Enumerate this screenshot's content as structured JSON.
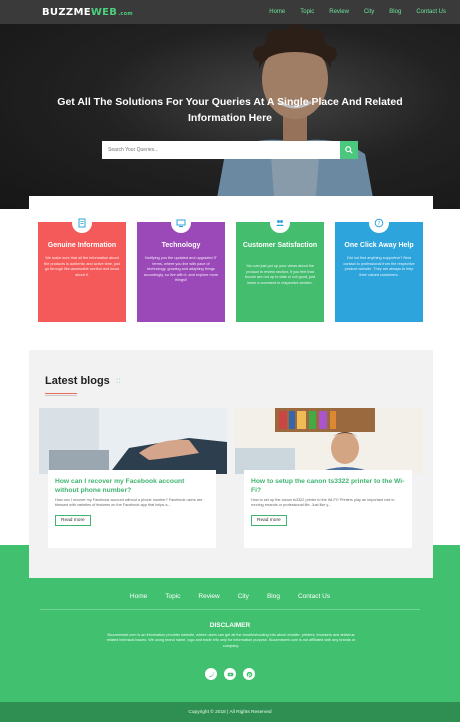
{
  "nav": {
    "logo_main": "BUZZME",
    "logo_accent": "WEB",
    "logo_domain": ".com",
    "links": [
      "Home",
      "Topic",
      "Review",
      "City",
      "Blog",
      "Contact Us"
    ]
  },
  "hero": {
    "title": "Get All The Solutions For Your Queries At A Single Place And Related Information Here",
    "search_placeholder": "Search Your Queries..."
  },
  "features": [
    {
      "title": "Genuine Information",
      "icon": "document-icon",
      "color": "#f45a5a",
      "text": "We make sure that all the information about the products is authentic and active time, just go through like-assessible section and know about it."
    },
    {
      "title": "Technology",
      "icon": "monitor-icon",
      "color": "#9b48b8",
      "text": "Notifying you the updated and upgraded IT terms, where you live with pace of technology, growing and adapting things accordingly, so live with it, and explore more things!!"
    },
    {
      "title": "Customer Satisfaction",
      "icon": "users-icon",
      "color": "#45bd6f",
      "text": "You can just put up your views about the product in review section, if you feel that buzzin are not up to date or not good, just leave a comment in respective section."
    },
    {
      "title": "One Click Away Help",
      "icon": "question-icon",
      "color": "#2da4db",
      "text": "Did not find anything supportive? Best contact to professional from the respective product website. They are always to help their valued customers."
    }
  ],
  "blogs": {
    "heading": "Latest blogs",
    "posts": [
      {
        "title": "How can I recover my Facebook account without phone number?",
        "excerpt": "How can I recover my Facebook account without a phone number? Facebook users are blessed with varieties of features on the Facebook app that helps a...",
        "read_more": "Read more"
      },
      {
        "title": "How to setup the canon ts3322 printer to the Wi-Fi?",
        "excerpt": "How to set up the canon ts3322 printer to the Wi-Fi? Printers play an important role in running errands or professional life. Just like y...",
        "read_more": "Read more"
      }
    ]
  },
  "footer": {
    "links": [
      "Home",
      "Topic",
      "Review",
      "City",
      "Blog",
      "Contact Us"
    ],
    "disclaimer_title": "DISCLAIMER",
    "disclaimer_text": "Buzzmeweb.com is an information provider website, where users can get all the troubleshooting info about emailer, printers, browsers and antivirus related technical issues. We using brand name, logo and trade info only for information purpose. Buzzmeweb.com is not affiliated with any brands or company.",
    "socials": [
      "twitter-icon",
      "youtube-icon",
      "pinterest-icon"
    ],
    "copyright": "Copyright © 2018 | All Rights Reserved"
  }
}
